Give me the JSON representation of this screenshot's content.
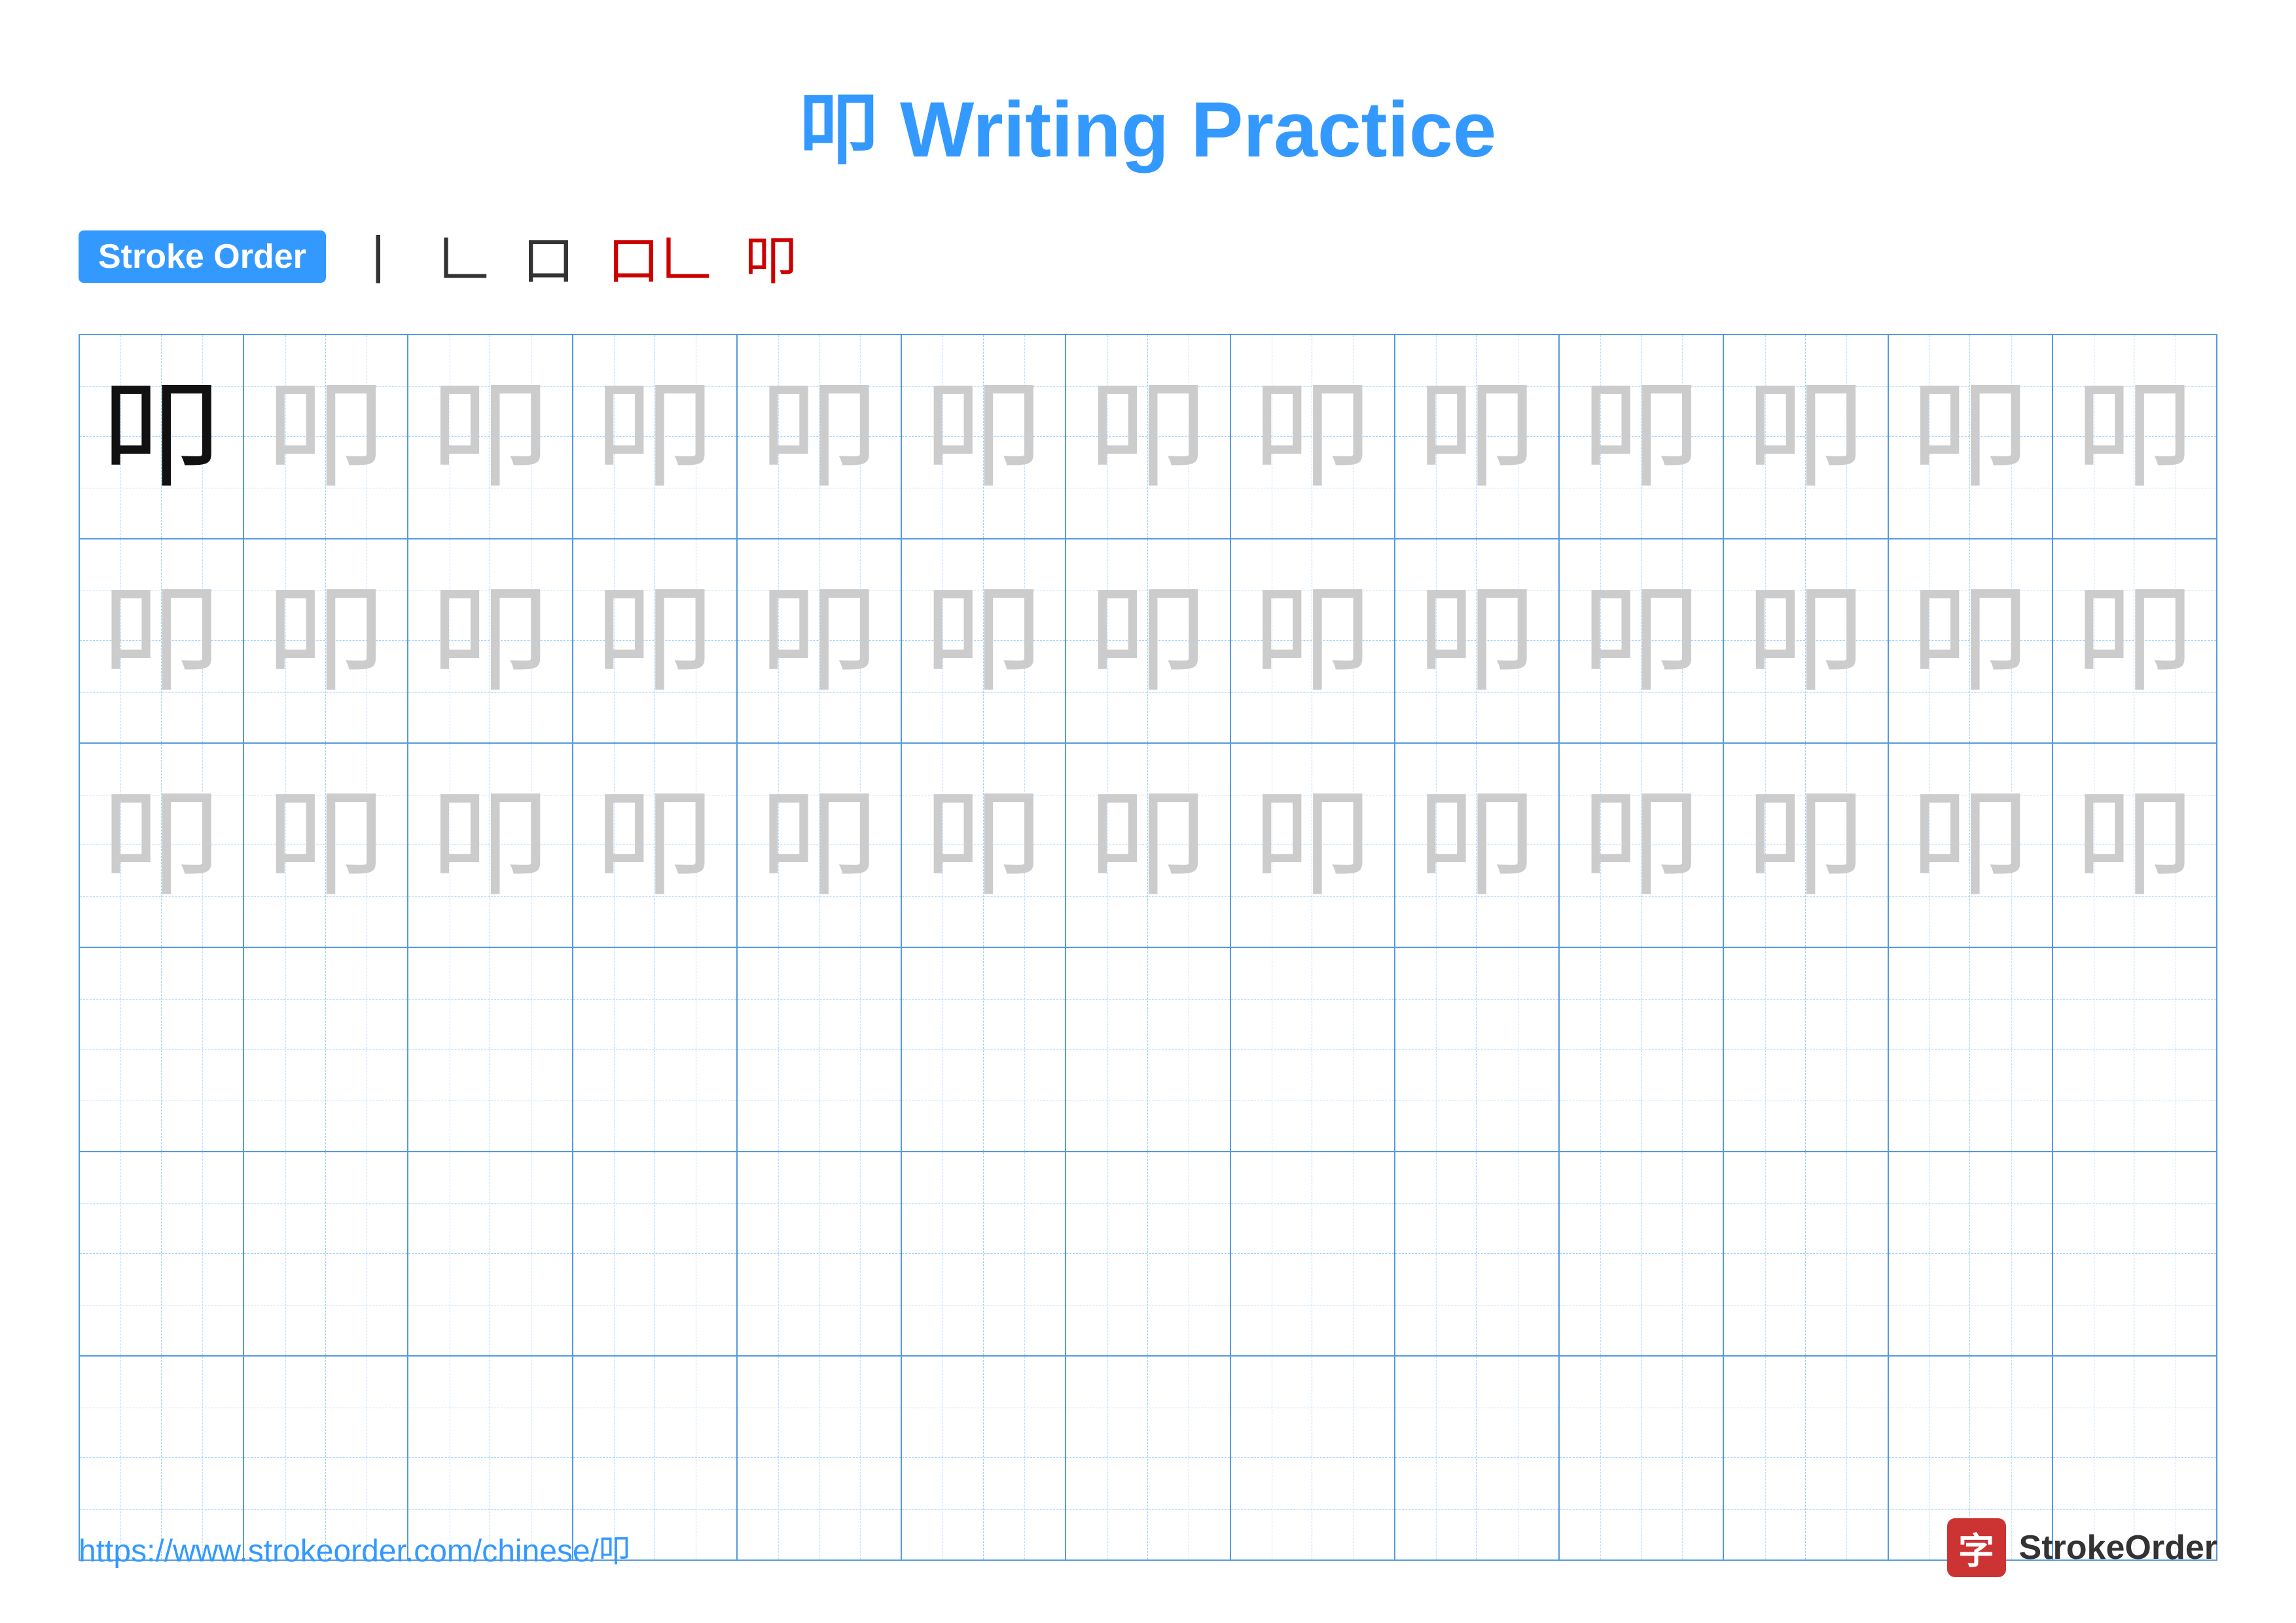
{
  "title": {
    "chinese": "叩",
    "english": "Writing Practice"
  },
  "stroke_order": {
    "badge_label": "Stroke Order",
    "strokes": [
      {
        "text": "⼁",
        "red": false
      },
      {
        "text": "𠃊",
        "red": false
      },
      {
        "text": "口",
        "red": false
      },
      {
        "text": "口𠃊",
        "red": true
      },
      {
        "text": "叩",
        "red": true
      }
    ]
  },
  "grid": {
    "rows": 6,
    "cols": 13,
    "char": "叩",
    "guide_char": "叩"
  },
  "footer": {
    "url": "https://www.strokeorder.com/chinese/叩",
    "logo_char": "字",
    "logo_text": "StrokeOrder"
  }
}
